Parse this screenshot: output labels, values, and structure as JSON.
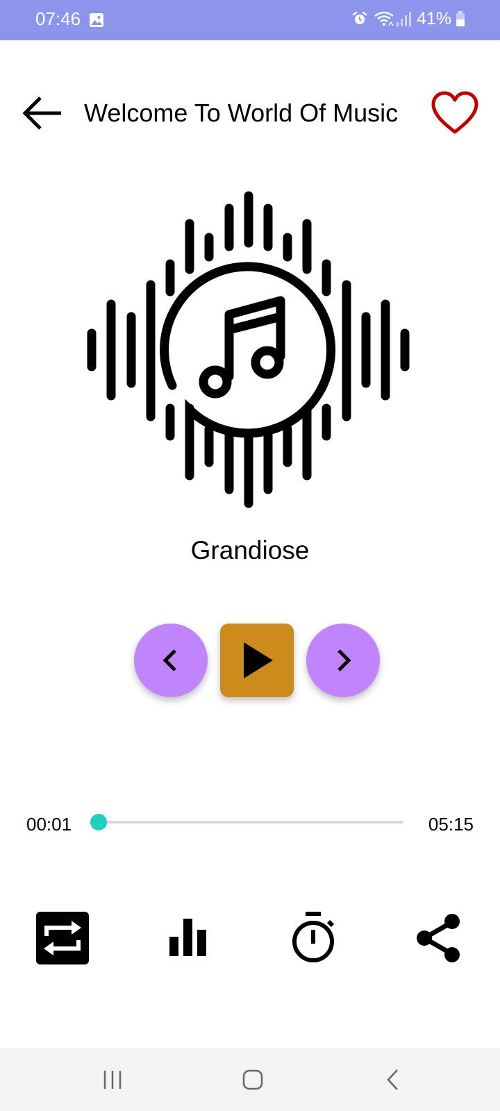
{
  "status_bar": {
    "time": "07:46",
    "battery_percent": "41%",
    "icons": [
      "gallery-icon",
      "alarm-icon",
      "wifi-icon",
      "signal-icon",
      "battery-icon"
    ],
    "background_color": "#8c94ec"
  },
  "header": {
    "title": "Welcome To World Of Music",
    "back_icon": "arrow-left-icon",
    "favorite_icon": "heart-outline-icon",
    "favorite_color": "#c00000"
  },
  "album_art": {
    "icon": "music-note-soundwave-icon"
  },
  "track": {
    "title": "Grandiose"
  },
  "playback_controls": {
    "previous_icon": "chevron-left-icon",
    "play_icon": "play-icon",
    "next_icon": "chevron-right-icon",
    "nav_button_color": "#c084fc",
    "play_button_color": "#cc8b1a"
  },
  "progress": {
    "current_time": "00:01",
    "total_time": "05:15",
    "fraction": 0.003,
    "thumb_color": "#1ed0bd"
  },
  "bottom_tools": [
    {
      "name": "repeat",
      "icon": "repeat-icon"
    },
    {
      "name": "equalizer",
      "icon": "equalizer-icon"
    },
    {
      "name": "timer",
      "icon": "timer-icon"
    },
    {
      "name": "share",
      "icon": "share-icon"
    }
  ],
  "system_nav": {
    "icons": [
      "recent-apps-icon",
      "home-icon",
      "back-icon"
    ]
  }
}
